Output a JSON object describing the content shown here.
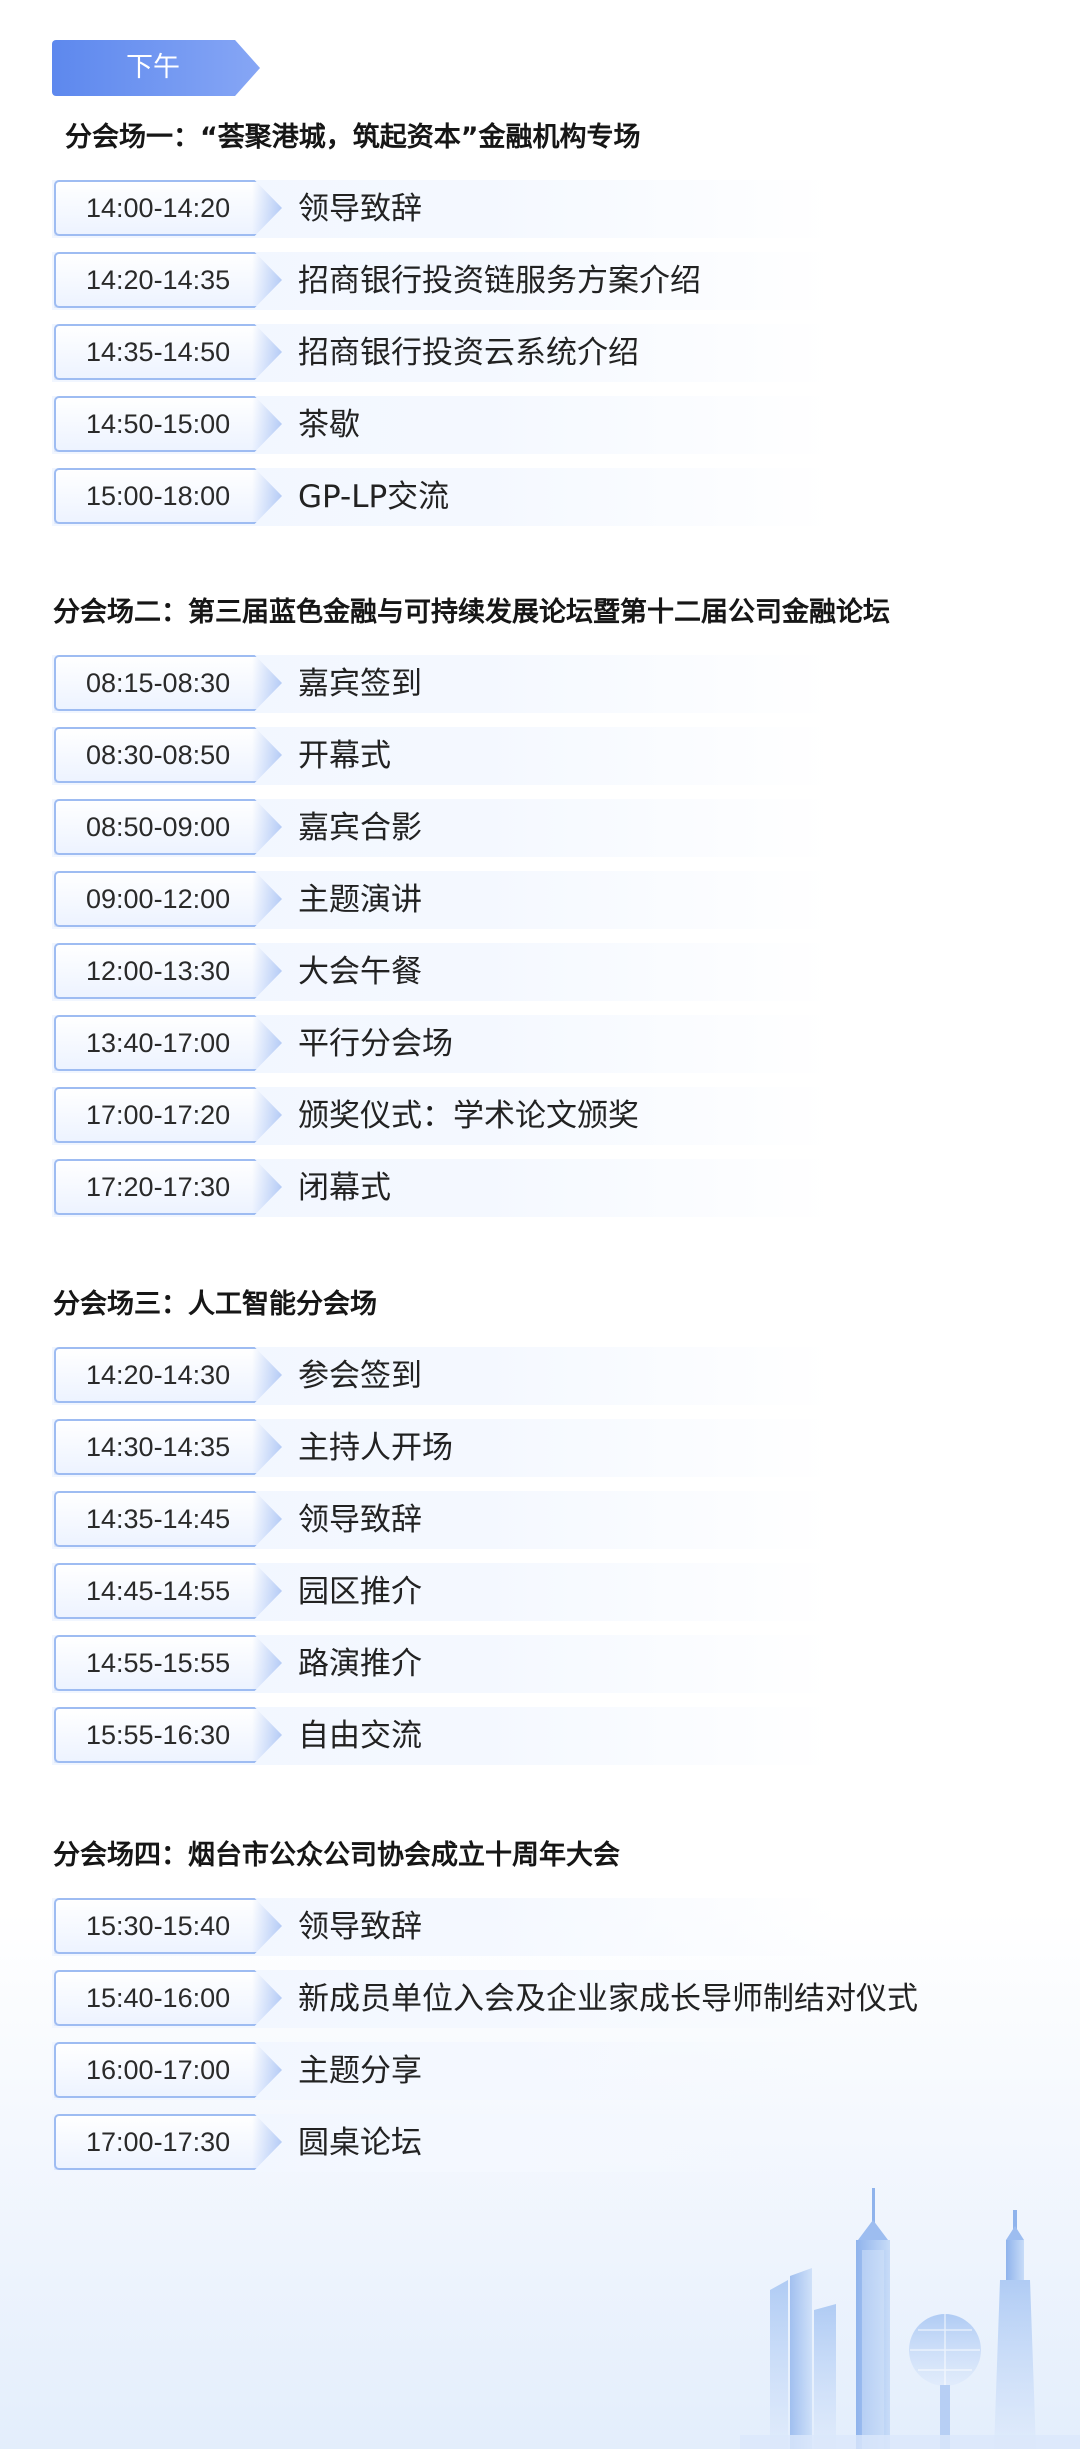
{
  "period_label": "下午",
  "sections": [
    {
      "title": "分会场一：“荟聚港城，筑起资本”金融机构专场",
      "items": [
        {
          "time": "14:00-14:20",
          "label": "领导致辞"
        },
        {
          "time": "14:20-14:35",
          "label": "招商银行投资链服务方案介绍"
        },
        {
          "time": "14:35-14:50",
          "label": "招商银行投资云系统介绍"
        },
        {
          "time": "14:50-15:00",
          "label": "茶歇"
        },
        {
          "time": "15:00-18:00",
          "label": "GP-LP交流"
        }
      ]
    },
    {
      "title": "分会场二：第三届蓝色金融与可持续发展论坛暨第十二届公司金融论坛",
      "items": [
        {
          "time": "08:15-08:30",
          "label": "嘉宾签到"
        },
        {
          "time": "08:30-08:50",
          "label": "开幕式"
        },
        {
          "time": "08:50-09:00",
          "label": "嘉宾合影"
        },
        {
          "time": "09:00-12:00",
          "label": "主题演讲"
        },
        {
          "time": "12:00-13:30",
          "label": "大会午餐"
        },
        {
          "time": "13:40-17:00",
          "label": "平行分会场"
        },
        {
          "time": "17:00-17:20",
          "label": "颁奖仪式：学术论文颁奖"
        },
        {
          "time": "17:20-17:30",
          "label": "闭幕式"
        }
      ]
    },
    {
      "title": "分会场三：人工智能分会场",
      "items": [
        {
          "time": "14:20-14:30",
          "label": "参会签到"
        },
        {
          "time": "14:30-14:35",
          "label": "主持人开场"
        },
        {
          "time": "14:35-14:45",
          "label": "领导致辞"
        },
        {
          "time": "14:45-14:55",
          "label": "园区推介"
        },
        {
          "time": "14:55-15:55",
          "label": "路演推介"
        },
        {
          "time": "15:55-16:30",
          "label": "自由交流"
        }
      ]
    },
    {
      "title": "分会场四：烟台市公众公司协会成立十周年大会",
      "items": [
        {
          "time": "15:30-15:40",
          "label": "领导致辞"
        },
        {
          "time": "15:40-16:00",
          "label": "新成员单位入会及企业家成长导师制结对仪式"
        },
        {
          "time": "16:00-17:00",
          "label": "主题分享"
        },
        {
          "time": "17:00-17:30",
          "label": "圆桌论坛"
        }
      ]
    }
  ]
}
